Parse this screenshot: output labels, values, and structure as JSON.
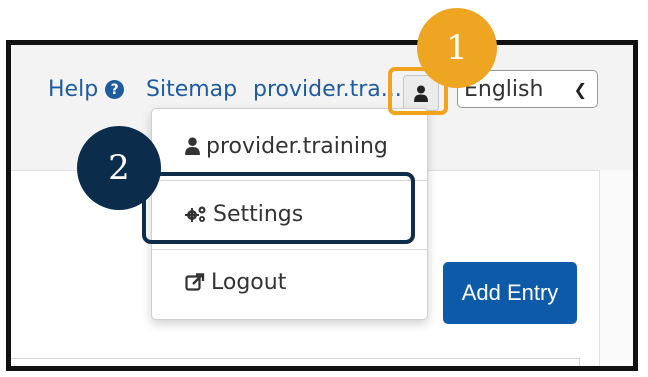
{
  "nav": {
    "help_label": "Help",
    "help_icon": "?",
    "sitemap_label": "Sitemap",
    "user_label": "provider.tra..."
  },
  "language": {
    "selected": "English"
  },
  "menu": {
    "user_label": "provider.training",
    "settings_label": "Settings",
    "logout_label": "Logout"
  },
  "add_entry_label": "Add Entry",
  "callouts": {
    "one": "1",
    "two": "2"
  },
  "colors": {
    "link": "#1f5b9e",
    "primary_button": "#0d5ba8",
    "callout_orange": "#eea521",
    "callout_navy": "#0c2c4c"
  }
}
